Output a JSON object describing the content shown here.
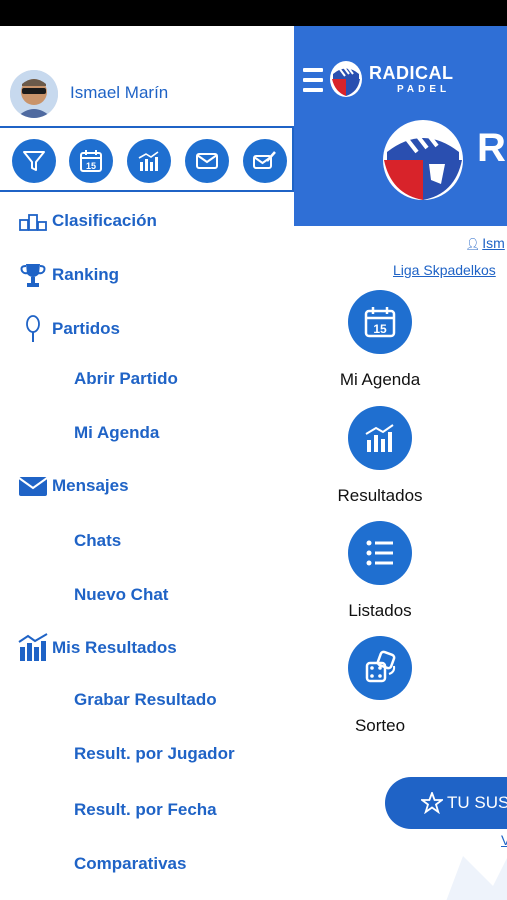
{
  "drawer": {
    "user_name": "Ismael Marín",
    "icon_bar": [
      {
        "icon": "filter-icon"
      },
      {
        "icon": "calendar-icon"
      },
      {
        "icon": "stats-chart-icon"
      },
      {
        "icon": "mail-icon"
      },
      {
        "icon": "compose-mail-icon"
      }
    ],
    "menu": {
      "clasificacion": "Clasificación",
      "ranking": "Ranking",
      "partidos": "Partidos",
      "abrir_partido": "Abrir Partido",
      "mi_agenda": "Mi Agenda",
      "mensajes": "Mensajes",
      "chats": "Chats",
      "nuevo_chat": "Nuevo Chat",
      "mis_resultados": "Mis Resultados",
      "grabar_resultado": "Grabar Resultado",
      "result_por_jugador": "Result. por Jugador",
      "result_por_fecha": "Result. por Fecha",
      "comparativas": "Comparativas"
    }
  },
  "header": {
    "brand": "RADICAL",
    "brand_sub": "PADEL",
    "big_letter": "R"
  },
  "main": {
    "user_link": "Ism",
    "liga_link": "Liga Skpadelkos",
    "tiles": {
      "agenda": "Mi Agenda",
      "resultados": "Resultados",
      "listados": "Listados",
      "sorteo": "Sorteo"
    },
    "subscription_button": "TU SUS",
    "v_link": "V"
  },
  "colors": {
    "accent": "#1f6fd0",
    "header_bg": "#2f6fd6",
    "link": "#1f63c6"
  }
}
